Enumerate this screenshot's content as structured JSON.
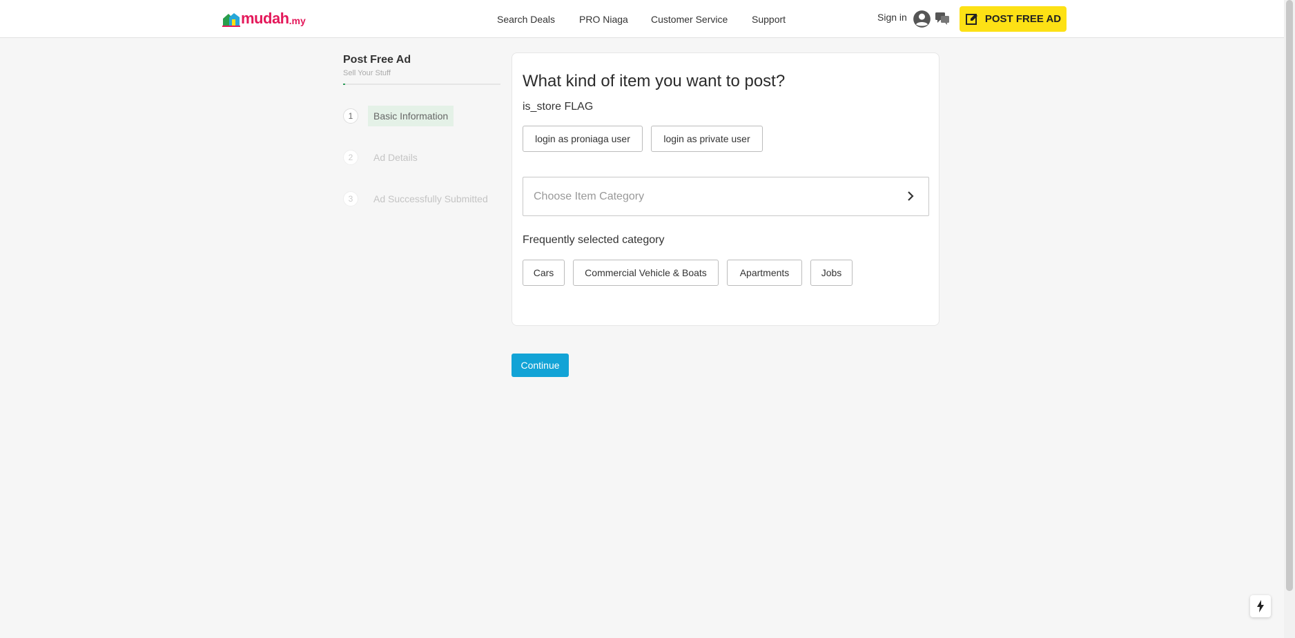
{
  "header": {
    "logo_text": "mudah",
    "logo_suffix": ".my",
    "nav": [
      "Search Deals",
      "PRO Niaga",
      "Customer Service",
      "Support"
    ],
    "sign_in": "Sign in",
    "post_button": "POST FREE AD"
  },
  "sidebar": {
    "title": "Post Free Ad",
    "subtitle": "Sell Your Stuff",
    "steps": [
      {
        "num": "1",
        "label": "Basic Information"
      },
      {
        "num": "2",
        "label": "Ad Details"
      },
      {
        "num": "3",
        "label": "Ad Successfully Submitted"
      }
    ]
  },
  "card": {
    "title": "What kind of item you want to post?",
    "flag": "is_store FLAG",
    "login_buttons": [
      "login as proniaga user",
      "login as private user"
    ],
    "category_placeholder": "Choose Item Category",
    "frequent_label": "Frequently selected category",
    "frequent": [
      "Cars",
      "Commercial Vehicle & Boats",
      "Apartments",
      "Jobs"
    ]
  },
  "continue_label": "Continue",
  "colors": {
    "brand": "#e4185a",
    "post_button": "#fde115",
    "continue": "#12a3d6",
    "progress": "#2e9b5a",
    "active_step_bg": "#e4f1e7"
  }
}
